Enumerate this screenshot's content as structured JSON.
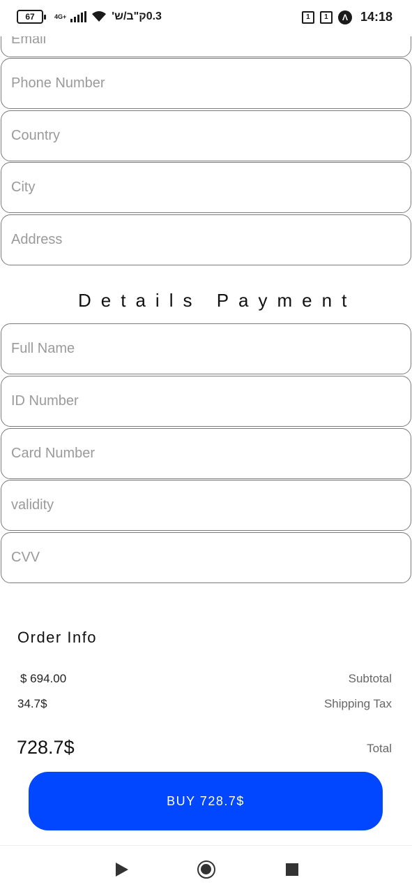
{
  "status_bar": {
    "battery": "67",
    "network": "4G+",
    "speed": "0.3ק\"ב/ש'",
    "icon_box_1": "1",
    "icon_box_2": "1",
    "circle_icon": "Λ",
    "time": "14:18"
  },
  "shipping_fields": {
    "email_placeholder": "Email",
    "phone_placeholder": "Phone Number",
    "country_placeholder": "Country",
    "city_placeholder": "City",
    "address_placeholder": "Address"
  },
  "payment": {
    "title": "Details Payment",
    "full_name_placeholder": "Full Name",
    "id_placeholder": "ID Number",
    "card_placeholder": "Card Number",
    "validity_placeholder": "validity",
    "cvv_placeholder": "CVV"
  },
  "order_info": {
    "title": "Order Info",
    "subtotal_value": "$ 694.00",
    "subtotal_label": "Subtotal",
    "shipping_value": "34.7$",
    "shipping_label": "Shipping Tax",
    "total_value": "728.7$",
    "total_label": "Total"
  },
  "buy_button": {
    "label": "BUY 728.7$",
    "color": "#0047ff"
  },
  "nav_bar": {
    "back_icon": "play-triangle-icon",
    "home_icon": "circle-home-icon",
    "recent_icon": "square-recent-icon"
  }
}
